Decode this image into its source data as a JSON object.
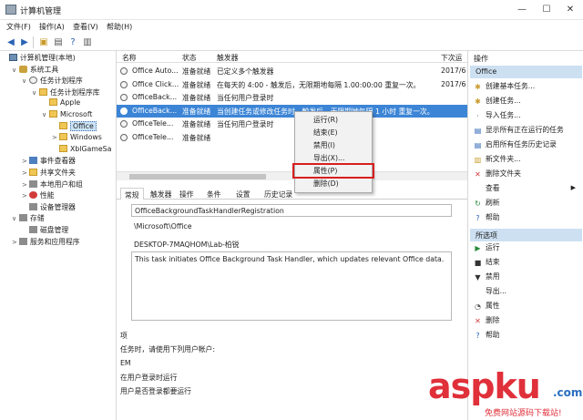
{
  "window": {
    "title": "计算机管理",
    "min": "—",
    "max": "☐",
    "close": "✕"
  },
  "menu": [
    "文件(F)",
    "操作(A)",
    "查看(V)",
    "帮助(H)"
  ],
  "tree": [
    {
      "label": "计算机管理(本地)",
      "indent": 0,
      "exp": "",
      "icon": "computer"
    },
    {
      "label": "系统工具",
      "indent": 1,
      "exp": "∨",
      "icon": "tools"
    },
    {
      "label": "任务计划程序",
      "indent": 2,
      "exp": "∨",
      "icon": "clock"
    },
    {
      "label": "任务计划程序库",
      "indent": 3,
      "exp": "∨",
      "icon": "folder"
    },
    {
      "label": "Apple",
      "indent": 4,
      "exp": "",
      "icon": "folder"
    },
    {
      "label": "Microsoft",
      "indent": 4,
      "exp": "∨",
      "icon": "folder"
    },
    {
      "label": "Office",
      "indent": 5,
      "exp": "",
      "icon": "folder",
      "selected": true
    },
    {
      "label": "Windows",
      "indent": 5,
      "exp": ">",
      "icon": "folder"
    },
    {
      "label": "XblGameSa",
      "indent": 5,
      "exp": "",
      "icon": "folder"
    },
    {
      "label": "事件查看器",
      "indent": 2,
      "exp": ">",
      "icon": "blue"
    },
    {
      "label": "共享文件夹",
      "indent": 2,
      "exp": ">",
      "icon": "folder"
    },
    {
      "label": "本地用户和组",
      "indent": 2,
      "exp": ">",
      "icon": "gray"
    },
    {
      "label": "性能",
      "indent": 2,
      "exp": ">",
      "icon": "red"
    },
    {
      "label": "设备管理器",
      "indent": 2,
      "exp": "",
      "icon": "gray"
    },
    {
      "label": "存储",
      "indent": 1,
      "exp": "∨",
      "icon": "gray"
    },
    {
      "label": "磁盘管理",
      "indent": 2,
      "exp": "",
      "icon": "gray"
    },
    {
      "label": "服务和应用程序",
      "indent": 1,
      "exp": ">",
      "icon": "gray"
    }
  ],
  "columns": [
    "名称",
    "状态",
    "触发器",
    "下次运"
  ],
  "tasks": [
    {
      "name": "Office Auto...",
      "status": "准备就绪",
      "trigger": "已定义多个触发器",
      "next": "2017/6"
    },
    {
      "name": "Office Click...",
      "status": "准备就绪",
      "trigger": "在每天的 4:00 - 触发后，无限期地每隔 1.00:00:00 重复一次。",
      "next": "2017/6"
    },
    {
      "name": "OfficeBack...",
      "status": "准备就绪",
      "trigger": "当任何用户登录时",
      "next": ""
    },
    {
      "name": "OfficeBack...",
      "status": "准备就绪",
      "trigger": "当创建任务或修改任务时 - 触发后，无限期地每隔 1 小时 重复一次。",
      "next": ""
    },
    {
      "name": "OfficeTele...",
      "status": "准备就绪",
      "trigger": "当任何用户登录时",
      "next": ""
    },
    {
      "name": "OfficeTele...",
      "status": "准备就绪",
      "trigger": "",
      "next": ""
    }
  ],
  "tabs": [
    "常规",
    "触发器",
    "操作",
    "条件",
    "设置",
    "历史记录"
  ],
  "details": {
    "task_name": "OfficeBackgroundTaskHandlerRegistration",
    "location": "\\Microsoft\\Office",
    "author": "DESKTOP-7MAQHOM\\Lab-柏锐",
    "description": "This task initiates Office Background Task Handler, which updates relevant Office data.",
    "sec_label": "项",
    "run_as": "任务时，请使用下列用户帐户:",
    "account": "EM",
    "only_logon": "在用户登录时运行",
    "more": "用户是否登录都要运行"
  },
  "context_menu": [
    "运行(R)",
    "结束(E)",
    "禁用(I)",
    "导出(X)...",
    "属性(P)",
    "删除(D)"
  ],
  "actions": {
    "header": "操作",
    "section1": "Office",
    "items1": [
      "创建基本任务...",
      "创建任务...",
      "导入任务...",
      "显示所有正在运行的任务",
      "启用所有任务历史记录",
      "新文件夹...",
      "删除文件夹",
      "查看",
      "刷新",
      "帮助"
    ],
    "section2": "所选项",
    "items2": [
      "运行",
      "结束",
      "禁用",
      "导出...",
      "属性",
      "删除",
      "帮助"
    ]
  },
  "watermark": {
    "main": "asp",
    "ku": "ku",
    "com": ".com",
    "sub": "免费网站源码下载站!"
  },
  "colors": {
    "selection": "#3c85d6",
    "highlight_box": "#d81e1e",
    "section_bg": "#cde0f2",
    "watermark": "#e0303a"
  }
}
